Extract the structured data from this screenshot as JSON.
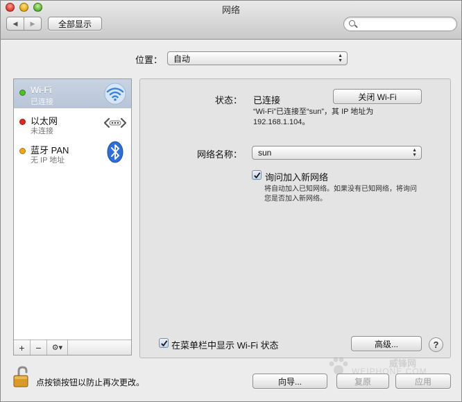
{
  "window": {
    "title": "网络"
  },
  "toolbar": {
    "back_glyph": "◀",
    "forward_glyph": "▶",
    "show_all_label": "全部显示",
    "search_value": ""
  },
  "location": {
    "label": "位置：",
    "value": "自动"
  },
  "services": [
    {
      "name": "Wi-Fi",
      "status": "已连接",
      "dot_color": "#4fbf2a",
      "icon": "wifi-icon",
      "selected": true
    },
    {
      "name": "以太网",
      "status": "未连接",
      "dot_color": "#e02a1f",
      "icon": "ethernet-icon",
      "selected": false
    },
    {
      "name": "蓝牙 PAN",
      "status": "无 IP 地址",
      "dot_color": "#f0a81a",
      "icon": "bluetooth-icon",
      "selected": false
    }
  ],
  "sidebar_bar": {
    "add": "+",
    "remove": "−",
    "gear": "⚙▾"
  },
  "detail": {
    "status_label": "状态：",
    "status_value": "已连接",
    "turn_off_label": "关闭 Wi-Fi",
    "status_desc_line1": "“Wi-Fi”已连接至“sun”，其 IP 地址为",
    "status_desc_line2": "192.168.1.104。",
    "network_name_label": "网络名称：",
    "network_name_value": "sun",
    "ask_join_label": "询问加入新网络",
    "ask_join_checked": true,
    "ask_join_note_line1": "将自动加入已知网络。如果没有已知网络，将询问",
    "ask_join_note_line2": "您是否加入新网络。",
    "show_menubar_label": "在菜单栏中显示 Wi-Fi 状态",
    "show_menubar_checked": true,
    "advanced_label": "高级...",
    "help_label": "?"
  },
  "footer": {
    "lock_text": "点按锁按钮以防止再次更改。",
    "assistant_label": "向导...",
    "revert_label": "复原",
    "apply_label": "应用"
  },
  "watermark": {
    "line1": "威锋网",
    "line2": "WEIPHONE.COM"
  },
  "colors": {
    "accent": "#3d84d9",
    "selection": "#bfcadb"
  }
}
